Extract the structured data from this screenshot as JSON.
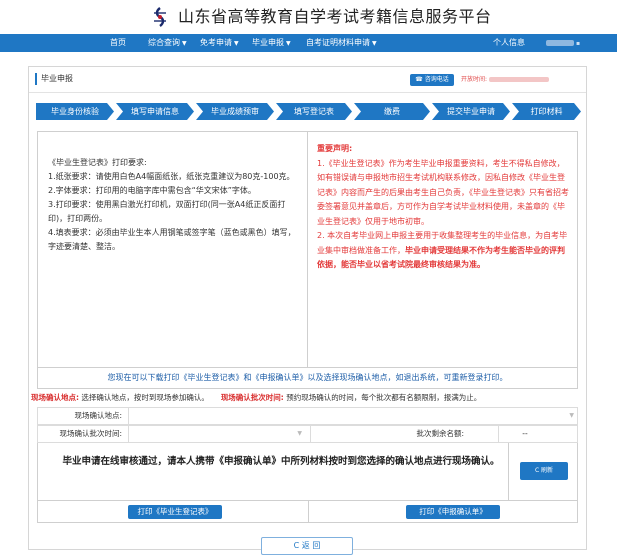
{
  "brand": {
    "title": "山东省高等教育自学考试考籍信息服务平台",
    "logo_icon": "shandong-logo-icon"
  },
  "nav": {
    "items": [
      {
        "label": "首页",
        "dropdown": false
      },
      {
        "label": "综合查询",
        "dropdown": true
      },
      {
        "label": "免考申请",
        "dropdown": true
      },
      {
        "label": "毕业申报",
        "dropdown": true
      },
      {
        "label": "自考证明材料申请",
        "dropdown": true
      }
    ],
    "user_info_label": "个人信息"
  },
  "panel": {
    "title": "毕业申报",
    "consult_label": "咨询电话",
    "open_time_label": "开放时间:"
  },
  "steps": [
    "毕业身份核验",
    "填写申请信息",
    "毕业成绩预审",
    "填写登记表",
    "缴费",
    "提交毕业申请",
    "打印材料"
  ],
  "requirements": {
    "heading": "《毕业生登记表》打印要求:",
    "lines": [
      "1.纸张要求：请使用白色A4幅面纸张，纸张克重建议为80克-100克。",
      "2.字体要求：打印用的电脑字库中需包含“华文宋体”字体。",
      "3.打印要求：使用黑白激光打印机，双面打印(同一张A4纸正反面打印)，打印两份。",
      "4.填表要求：必须由毕业生本人用钢笔或签字笔（蓝色或黑色）填写，字迹要清楚、整洁。"
    ]
  },
  "declaration": {
    "heading": "重要声明:",
    "p1": "1.《毕业生登记表》作为考生毕业申报重要资料，考生不得私自修改，如有错误请与申报地市招生考试机构联系修改，因私自修改《毕业生登记表》内容而产生的后果由考生自己负责，《毕业生登记表》只有省招考委签署意见并盖章后，方可作为自学考试毕业材料使用，未盖章的《毕业生登记表》仅用于地市初审。",
    "p2_normal": "2. 本次自考毕业网上申报主要用于收集整理考生的毕业信息，为自考毕业集中审档做准备工作，",
    "p2_bold": "毕业申请受理结果不作为考生能否毕业的评判依据，能否毕业以省考试院最终审核结果为准。"
  },
  "note": "您现在可以下载打印《毕业生登记表》和《申报确认单》以及选择现场确认地点，如退出系统，可重新登录打印。",
  "onsite": {
    "location_label": "现场确认地点:",
    "location_desc": "选择确认地点，按时到现场参加确认。",
    "batch_label": "现场确认批次时间:",
    "batch_desc": "预约现场确认的时间，每个批次都有名额限制，报满为止。"
  },
  "form": {
    "location_field_label": "现场确认地点:",
    "batch_field_label": "现场确认批次时间:",
    "remaining_label": "批次剩余名额:",
    "remaining_value": "--"
  },
  "confirm_text": "毕业申请在线审核通过，请本人携带《申报确认单》中所列材料按时到您选择的确认地点进行现场确认。",
  "refresh_label": "C 刷新",
  "print": {
    "graduate_form_label": "打印《毕业生登记表》",
    "confirm_form_label": "打印《申报确认单》"
  },
  "back_label": "C 返 回",
  "colors": {
    "primary": "#1f77c4",
    "alert": "#e33a3a",
    "note": "#1f5fa8"
  }
}
